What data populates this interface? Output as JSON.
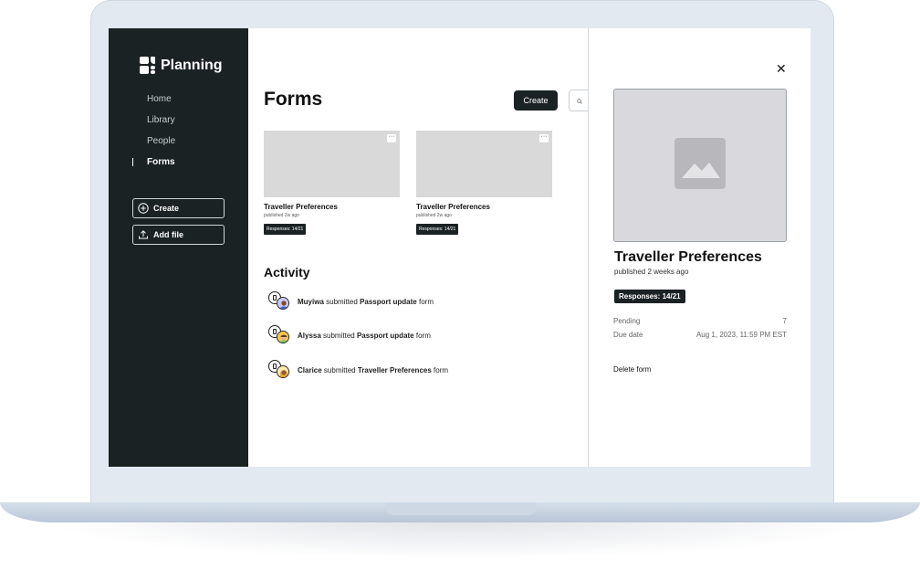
{
  "app": {
    "name": "Planning"
  },
  "sidebar": {
    "items": [
      {
        "label": "Home"
      },
      {
        "label": "Library"
      },
      {
        "label": "People"
      },
      {
        "label": "Forms"
      }
    ],
    "create_label": "Create",
    "add_file_label": "Add file"
  },
  "main": {
    "title": "Forms",
    "create_label": "Create",
    "cards": [
      {
        "title": "Traveller Preferences",
        "subtitle": "published 2w ago",
        "badge": "Responses: 14/21"
      },
      {
        "title": "Traveller Preferences",
        "subtitle": "published 2w ago",
        "badge": "Responses: 14/21"
      }
    ],
    "activity_title": "Activity",
    "activity": [
      {
        "name": "Muyiwa",
        "verb": "submitted",
        "form": "Passport update",
        "suffix": "form"
      },
      {
        "name": "Alyssa",
        "verb": "submitted",
        "form": "Passport update",
        "suffix": "form"
      },
      {
        "name": "Clarice",
        "verb": "submitted",
        "form": "Traveller Preferences",
        "suffix": "form"
      }
    ]
  },
  "panel": {
    "title": "Traveller Preferences",
    "subtitle": "published 2 weeks ago",
    "badge": "Responses: 14/21",
    "pending_label": "Pending",
    "pending_value": "7",
    "due_label": "Due date",
    "due_value": "Aug 1, 2023, 11:59 PM EST",
    "delete_label": "Delete form",
    "close_glyph": "✕"
  },
  "colors": {
    "sidebar_bg": "#1b2224",
    "accent_dark": "#1b2224",
    "placeholder_gray": "#d9d9d9"
  }
}
